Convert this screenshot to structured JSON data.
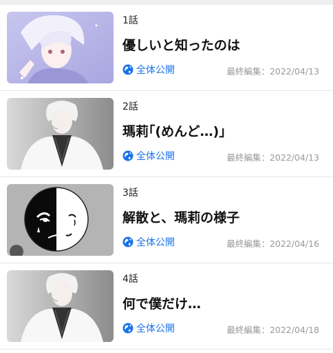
{
  "episodes": [
    {
      "number": "1話",
      "title": "優しいと知ったのは",
      "visibility": "全体公開",
      "edited": "最終編集：2022/04/13",
      "thumbnail_icon": "anime-boy-purple-illustration"
    },
    {
      "number": "2話",
      "title": "瑪莉｢(めんど…)｣",
      "visibility": "全体公開",
      "edited": "最終編集：2022/04/13",
      "thumbnail_icon": "anime-boy-white-shirt-illustration"
    },
    {
      "number": "3話",
      "title": "解散と、瑪莉の様子",
      "visibility": "全体公開",
      "edited": "最終編集：2022/04/16",
      "thumbnail_icon": "black-white-face-illustration"
    },
    {
      "number": "4話",
      "title": "何で僕だけ…",
      "visibility": "全体公開",
      "edited": "最終編集：2022/04/18",
      "thumbnail_icon": "anime-boy-white-shirt-illustration"
    }
  ],
  "colors": {
    "link": "#1a73e8",
    "muted": "#999999",
    "divider": "#e6e6e6"
  }
}
